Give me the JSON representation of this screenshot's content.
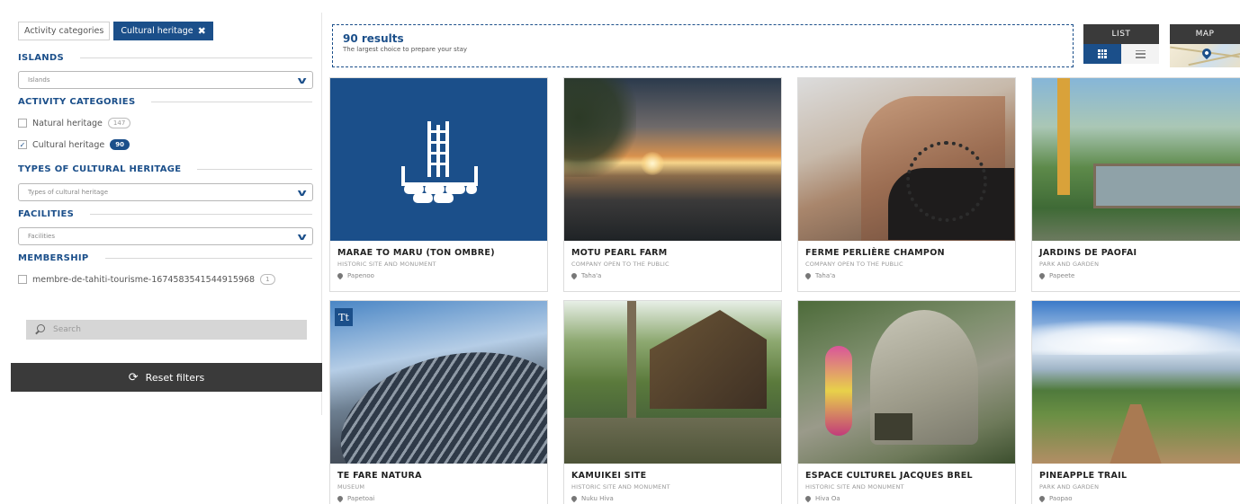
{
  "filters": {
    "chips": [
      {
        "label": "Activity categories"
      },
      {
        "label": "Cultural heritage",
        "remove": "✖"
      }
    ],
    "islands": {
      "title": "ISLANDS",
      "placeholder": "Islands"
    },
    "activity_categories": {
      "title": "ACTIVITY CATEGORIES",
      "options": [
        {
          "label": "Natural heritage",
          "count": "147",
          "checked": false
        },
        {
          "label": "Cultural heritage",
          "count": "90",
          "checked": true
        }
      ]
    },
    "types": {
      "title": "TYPES OF CULTURAL HERITAGE",
      "placeholder": "Types of cultural heritage"
    },
    "facilities": {
      "title": "FACILITIES",
      "placeholder": "Facilities"
    },
    "membership": {
      "title": "MEMBERSHIP",
      "options": [
        {
          "label": "membre-de-tahiti-tourisme-1674583541544915968",
          "count": "1",
          "checked": false
        }
      ]
    },
    "search_placeholder": "Search",
    "reset_label": "Reset filters"
  },
  "results": {
    "count": "90 results",
    "subtitle": "The largest choice to prepare your stay"
  },
  "views": {
    "list_label": "LIST",
    "map_label": "MAP"
  },
  "cards": [
    {
      "title": "MARAE TO MARU (TON OMBRE)",
      "type": "HISTORIC SITE AND MONUMENT",
      "location": "Papenoo"
    },
    {
      "title": "MOTU PEARL FARM",
      "type": "COMPANY OPEN TO THE PUBLIC",
      "location": "Taha'a"
    },
    {
      "title": "FERME PERLIÈRE CHAMPON",
      "type": "COMPANY OPEN TO THE PUBLIC",
      "location": "Taha'a"
    },
    {
      "title": "JARDINS DE PAOFAI",
      "type": "PARK AND GARDEN",
      "location": "Papeete"
    },
    {
      "title": "TE FARE NATURA",
      "type": "MUSEUM",
      "location": "Papetoai"
    },
    {
      "title": "KAMUIKEI SITE",
      "type": "HISTORIC SITE AND MONUMENT",
      "location": "Nuku Hiva"
    },
    {
      "title": "ESPACE CULTUREL JACQUES BREL",
      "type": "HISTORIC SITE AND MONUMENT",
      "location": "Hiva Oa"
    },
    {
      "title": "PINEAPPLE TRAIL",
      "type": "PARK AND GARDEN",
      "location": "Paopao"
    }
  ],
  "colors": {
    "brand": "#1b4f8a",
    "dark": "#3a3a3a"
  },
  "badge_text": "Tt"
}
